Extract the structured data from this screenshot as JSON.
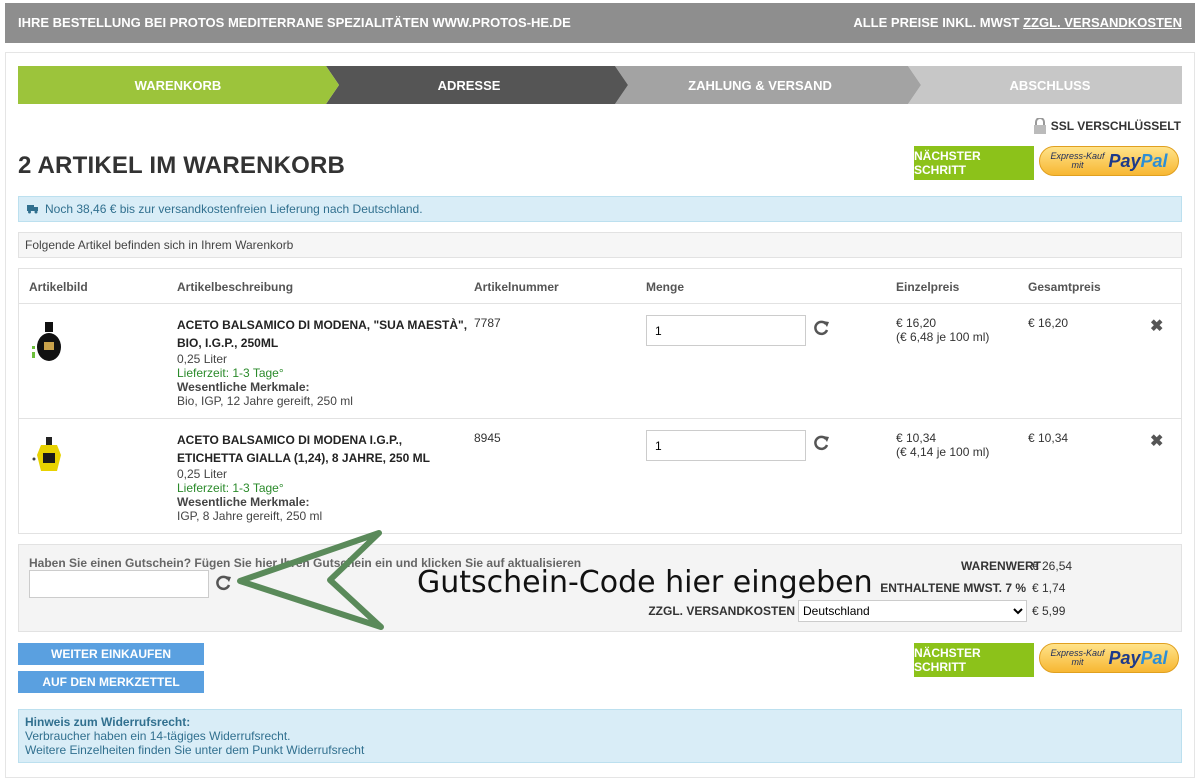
{
  "topbar": {
    "left": "IHRE BESTELLUNG BEI PROTOS MEDITERRANE SPEZIALITÄTEN WWW.PROTOS-HE.DE",
    "right_prefix": "ALLE PREISE INKL. MWST",
    "right_link": "ZZGL. VERSANDKOSTEN"
  },
  "steps": [
    {
      "label": "WARENKORB",
      "color": "#9cc43b"
    },
    {
      "label": "ADRESSE",
      "color": "#555555"
    },
    {
      "label": "ZAHLUNG & VERSAND",
      "color": "#a3a3a3"
    },
    {
      "label": "ABSCHLUSS",
      "color": "#c7c7c7"
    }
  ],
  "ssl": "SSL VERSCHLÜSSELT",
  "page_title": "2 ARTIKEL IM WARENKORB",
  "next_step": "NÄCHSTER SCHRITT",
  "paypal": {
    "express": "Express-Kauf",
    "mit": "mit",
    "pay": "Pay",
    "pal": "Pal"
  },
  "shipping_info": "Noch 38,46 € bis zur versandkostenfreien Lieferung nach Deutschland.",
  "cart_note": "Folgende Artikel befinden sich in Ihrem Warenkorb",
  "columns": [
    "Artikelbild",
    "Artikelbeschreibung",
    "Artikelnummer",
    "Menge",
    "Einzelpreis",
    "Gesamtpreis"
  ],
  "items": [
    {
      "name": "ACETO BALSAMICO DI MODENA, \"SUA MAESTÀ\", BIO, I.G.P., 250ML",
      "size": "0,25 Liter",
      "delivery": "Lieferzeit: 1-3 Tage°",
      "features_label": "Wesentliche Merkmale:",
      "features": "Bio, IGP, 12 Jahre gereift, 250 ml",
      "article_no": "7787",
      "qty": "1",
      "unit_price": "€ 16,20",
      "base_price": "(€ 6,48 je 100 ml)",
      "total": "€ 16,20"
    },
    {
      "name": "ACETO BALSAMICO DI MODENA I.G.P., ETICHETTA GIALLA (1,24), 8 JAHRE, 250 ML",
      "size": "0,25 Liter",
      "delivery": "Lieferzeit: 1-3 Tage°",
      "features_label": "Wesentliche Merkmale:",
      "features": "IGP, 8 Jahre gereift, 250 ml",
      "article_no": "8945",
      "qty": "1",
      "unit_price": "€ 10,34",
      "base_price": "(€ 4,14 je 100 ml)",
      "total": "€ 10,34"
    }
  ],
  "coupon": {
    "label": "Haben Sie einen Gutschein? Fügen Sie hier Ihren Gutschein ein und klicken Sie auf aktualisieren",
    "value": ""
  },
  "summary": {
    "warenwert_label": "WARENWERT",
    "warenwert": "€ 26,54",
    "mwst_label": "ENTHALTENE MWST. 7 %",
    "mwst": "€ 1,74",
    "versand_label": "ZZGL. VERSANDKOSTEN",
    "versand_country": "Deutschland",
    "versand": "€ 5,99"
  },
  "buttons": {
    "continue": "WEITER EINKAUFEN",
    "wishlist": "AUF DEN MERKZETTEL"
  },
  "hint": {
    "title": "Hinweis zum Widerrufsrecht:",
    "line1": "Verbraucher haben ein 14-tägiges Widerrufsrecht.",
    "line2": "Weitere Einzelheiten finden Sie unter dem Punkt Widerrufsrecht"
  },
  "annotation": "Gutschein-Code hier eingeben"
}
